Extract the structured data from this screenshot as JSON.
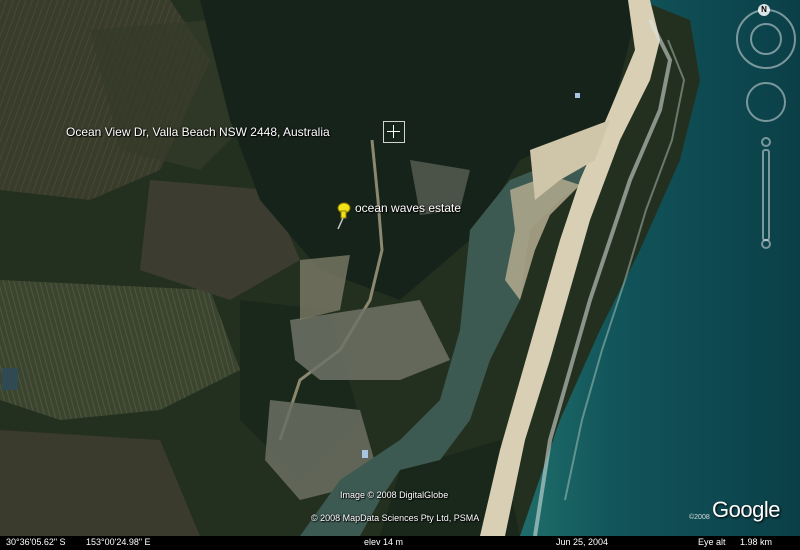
{
  "labels": {
    "address": "Ocean View Dr, Valla Beach NSW 2448, Australia",
    "placemark": "ocean waves estate"
  },
  "credits": {
    "image": "Image © 2008 DigitalGlobe",
    "data": "© 2008 MapData Sciences Pty Ltd, PSMA"
  },
  "logo": {
    "text": "Google",
    "year": "©2008"
  },
  "status": {
    "lat": "30°36'05.62\" S",
    "lon": "153°00'24.98\" E",
    "elev": "elev   14 m",
    "date": "Jun 25, 2004",
    "eye_alt_label": "Eye alt",
    "eye_alt_value": "1.98 km"
  },
  "compass": {
    "north": "N"
  },
  "icons": {
    "placemark": "yellow-pushpin-icon",
    "crosshair": "crosshair-icon",
    "compass": "compass-ring-icon",
    "look": "look-joystick-icon",
    "zoom": "zoom-slider-icon"
  },
  "colors": {
    "pin": "#f2e21a",
    "ocean": "#0f4a4f",
    "sand": "#d8cfb5",
    "land": "#1d2c1c"
  }
}
